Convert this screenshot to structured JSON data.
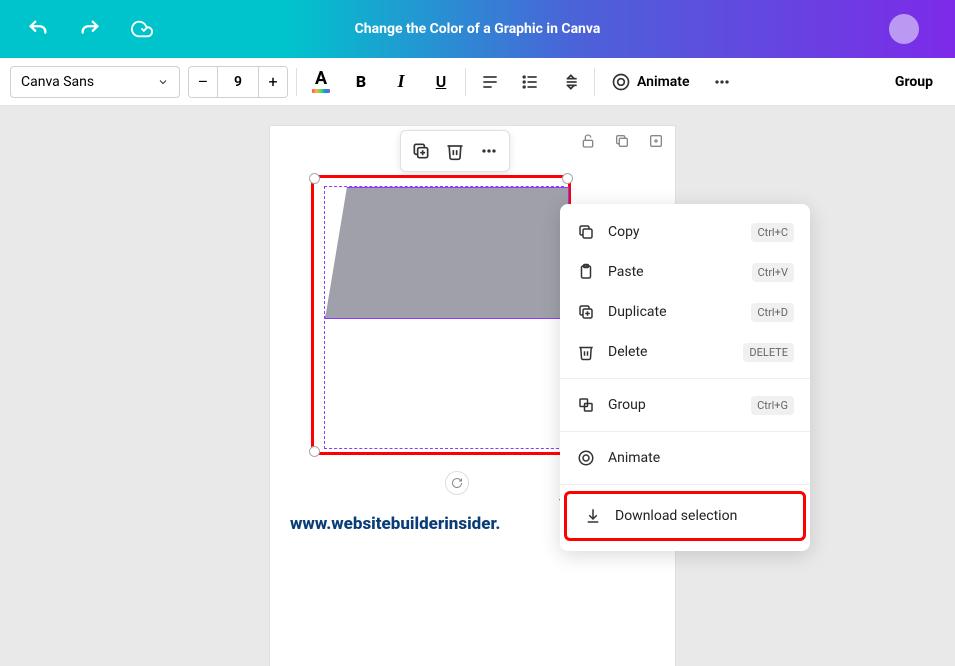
{
  "header": {
    "title": "Change the Color of a Graphic in Canva"
  },
  "toolbar": {
    "font_name": "Canva Sans",
    "font_size": "9",
    "decrease": "–",
    "increase": "+",
    "text_color_label": "A",
    "bold": "B",
    "italic": "I",
    "underline": "U",
    "animate": "Animate",
    "group": "Group"
  },
  "context_menu": {
    "copy": {
      "label": "Copy",
      "shortcut": "Ctrl+C"
    },
    "paste": {
      "label": "Paste",
      "shortcut": "Ctrl+V"
    },
    "duplicate": {
      "label": "Duplicate",
      "shortcut": "Ctrl+D"
    },
    "delete": {
      "label": "Delete",
      "shortcut": "DELETE"
    },
    "group": {
      "label": "Group",
      "shortcut": "Ctrl+G"
    },
    "animate": {
      "label": "Animate"
    },
    "download": {
      "label": "Download selection"
    }
  },
  "watermark": "www.websitebuilderinsider."
}
